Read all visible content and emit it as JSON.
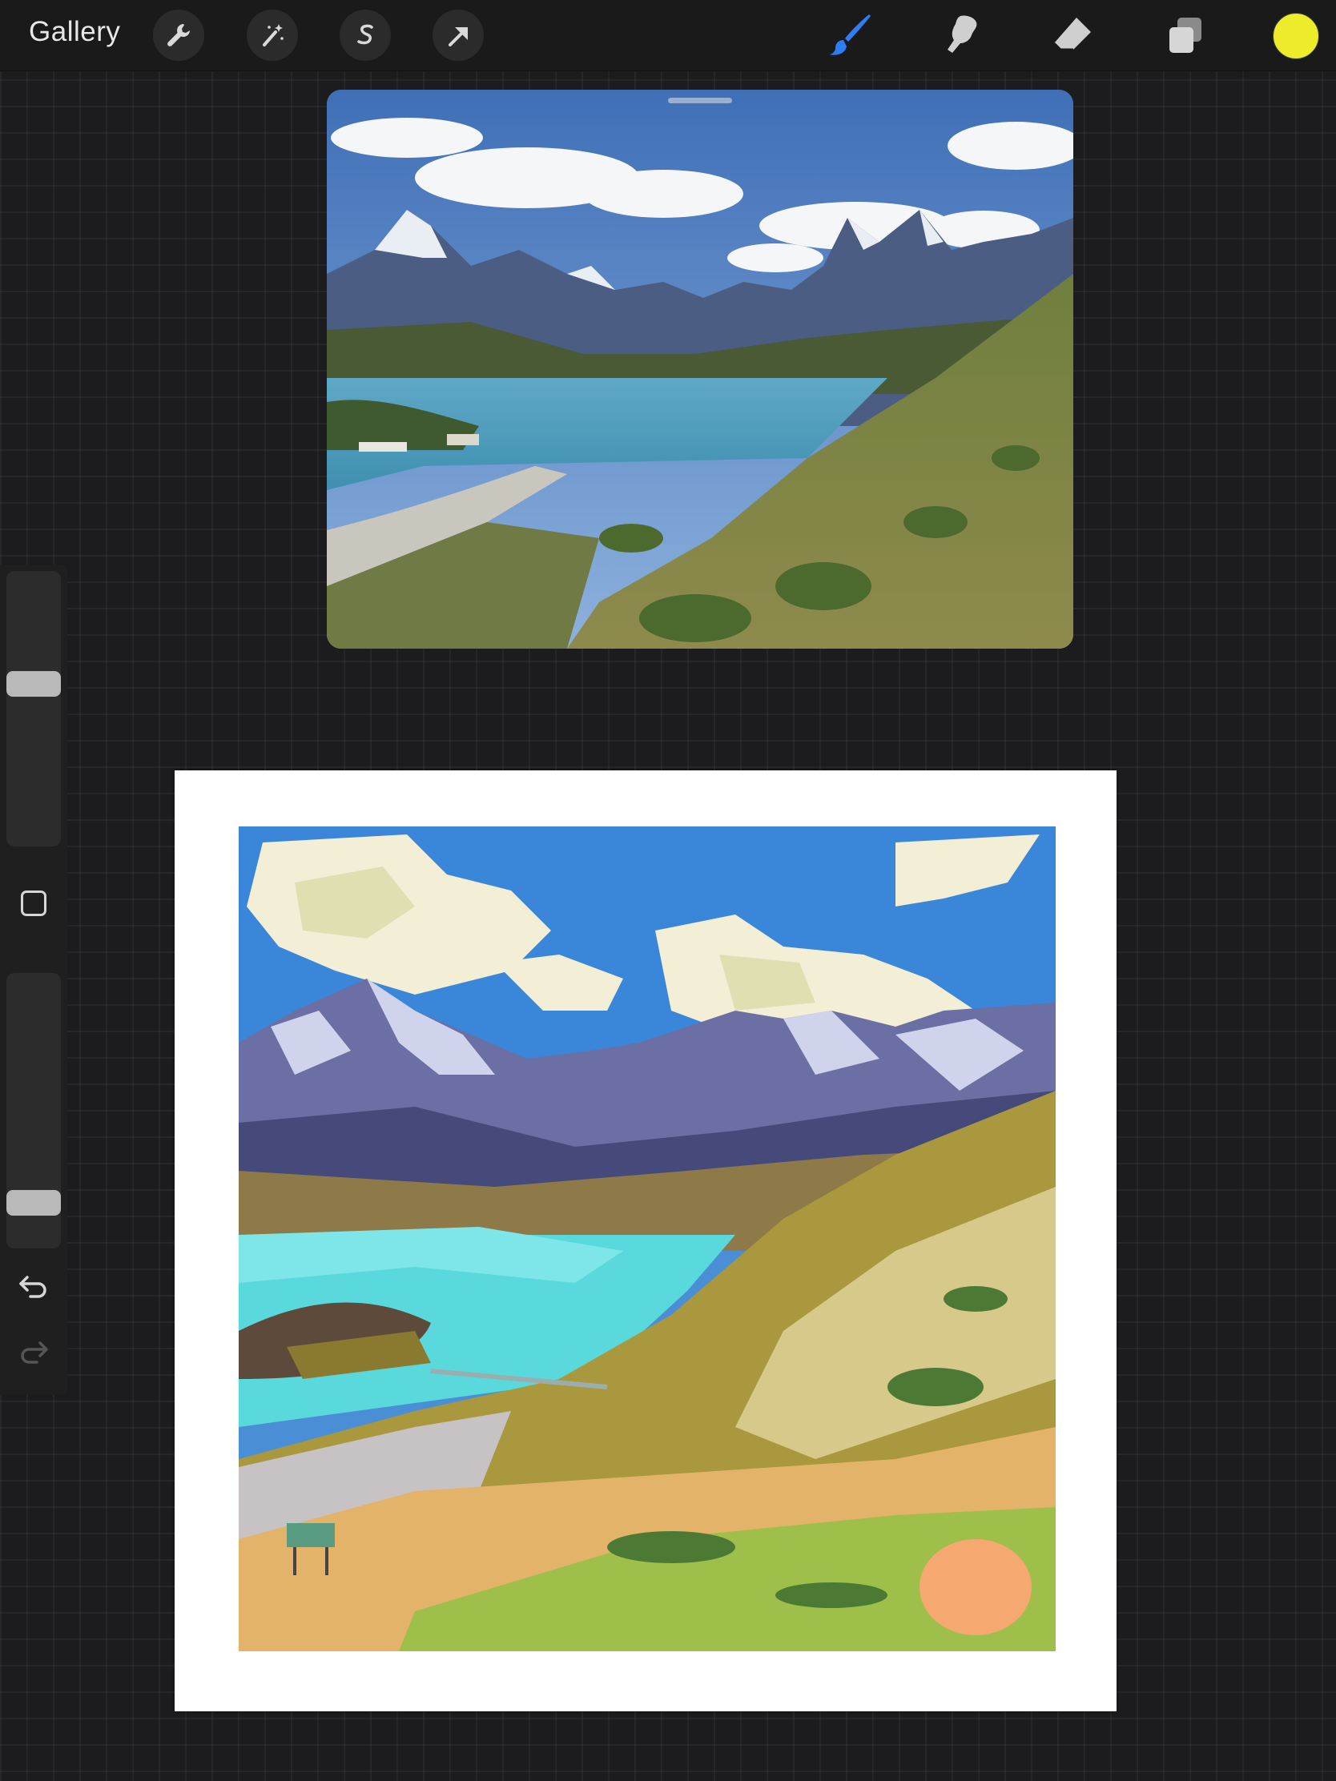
{
  "toolbar": {
    "gallery_label": "Gallery",
    "left_tools": [
      "wrench-icon",
      "magic-wand-icon",
      "selection-s-icon",
      "transform-arrow-icon"
    ],
    "right_tools": [
      "brush-icon",
      "smudge-icon",
      "eraser-icon",
      "layers-icon"
    ],
    "active_tool": "brush-icon",
    "active_color": "#ecec2a",
    "accent": "#2f7df6"
  },
  "reference_window": {
    "content": "mountain-lake-photo"
  },
  "sidebar": {
    "brush_size_level": 0.6,
    "opacity_level": 0.13,
    "modify_button_icon": "square-icon",
    "undo_icon": "undo-icon",
    "redo_icon": "redo-icon"
  },
  "canvas": {
    "content": "painted-mountain-lake-landscape"
  }
}
